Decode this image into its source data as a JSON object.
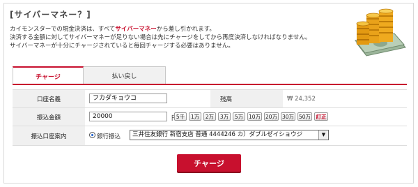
{
  "heading": "[サイバーマネー？]",
  "description": {
    "line1_prefix": "カイモンスターでの現金決済は、すべて",
    "line1_highlight": "サイバーマネー",
    "line1_suffix": "から差し引かれます。",
    "line2": "決済する金額に対してサイバーマネーが足りない場合は先にチャージをしてから再度決済しなければなりません。",
    "line3": "サイバーマネーが十分にチャージされていると毎回チャージする必要はありません。"
  },
  "tabs": [
    {
      "label": "チャージ",
      "active": true
    },
    {
      "label": "払い戻し",
      "active": false
    }
  ],
  "form": {
    "account_name_label": "口座名義",
    "account_name_value": "フカダキョウコ",
    "balance_label": "残高",
    "balance_value": "₩ 24,352",
    "amount_label": "振込金額",
    "amount_value": "20000",
    "amount_unit": "円",
    "quick_amounts": [
      "5千",
      "1万",
      "2万",
      "3万",
      "5万",
      "10万",
      "20万",
      "30万",
      "50万"
    ],
    "correct_label": "訂正",
    "guide_label": "振込口座案内",
    "radio_label": "銀行振込",
    "bank_select_value": "三井住友銀行 新宿支店 普通 4444246 カ）ダブルゼイショウジ"
  },
  "submit_label": "チャージ",
  "colors": {
    "accent": "#c8102e",
    "label_bg": "#f0f0f0"
  }
}
